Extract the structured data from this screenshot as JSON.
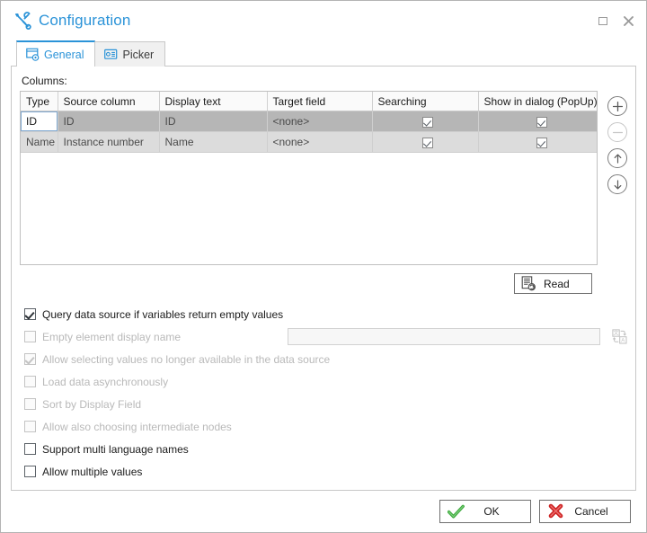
{
  "window": {
    "title": "Configuration",
    "title_icon": "tools-icon",
    "buttons": {
      "maximize": "maximize-icon",
      "close": "close-icon"
    }
  },
  "tabs": [
    {
      "label": "General",
      "icon": "window-gear-icon",
      "active": true
    },
    {
      "label": "Picker",
      "icon": "card-list-icon",
      "active": false
    }
  ],
  "general": {
    "columns_label": "Columns:",
    "grid": {
      "headers": [
        "Type",
        "Source column",
        "Display text",
        "Target field",
        "Searching",
        "Show in dialog (PopUp)"
      ],
      "rows": [
        {
          "type": "ID",
          "source_column": "ID",
          "display_text": "ID",
          "target_field": "<none>",
          "searching": true,
          "show_in_dialog": true,
          "selected": true,
          "editing_cell": "type"
        },
        {
          "type": "Name",
          "source_column": "Instance number",
          "display_text": "Name",
          "target_field": "<none>",
          "searching": true,
          "show_in_dialog": true,
          "selected": false,
          "editing_cell": null
        }
      ]
    },
    "side_tools": [
      {
        "name": "add-row-button",
        "icon": "plus-circle-icon",
        "disabled": false
      },
      {
        "name": "remove-row-button",
        "icon": "minus-circle-icon",
        "disabled": true
      },
      {
        "name": "move-up-button",
        "icon": "arrow-up-circle-icon",
        "disabled": false
      },
      {
        "name": "move-down-button",
        "icon": "arrow-down-circle-icon",
        "disabled": false
      }
    ],
    "read_button": {
      "label": "Read",
      "icon": "read-data-icon"
    },
    "options": [
      {
        "label": "Query data source if variables return empty values",
        "checked": true,
        "disabled": false,
        "has_input": false
      },
      {
        "label": "Empty element display name",
        "checked": false,
        "disabled": true,
        "has_input": true,
        "input_value": "",
        "input_placeholder": ""
      },
      {
        "label": "Allow selecting values no longer available in the data source",
        "checked": true,
        "disabled": true,
        "has_input": false
      },
      {
        "label": "Load data asynchronously",
        "checked": false,
        "disabled": true,
        "has_input": false
      },
      {
        "label": "Sort by Display Field",
        "checked": false,
        "disabled": true,
        "has_input": false
      },
      {
        "label": "Allow also choosing intermediate nodes",
        "checked": false,
        "disabled": true,
        "has_input": false
      },
      {
        "label": "Support multi language names",
        "checked": false,
        "disabled": false,
        "has_input": false
      },
      {
        "label": "Allow multiple values",
        "checked": false,
        "disabled": false,
        "has_input": false
      }
    ]
  },
  "footer": {
    "ok_label": "OK",
    "cancel_label": "Cancel",
    "ok_icon": "green-check-icon",
    "cancel_icon": "red-x-icon"
  },
  "colors": {
    "accent": "#2b93d8",
    "ok_green": "#3faa3f",
    "cancel_red": "#cc2222",
    "row_selected": "#b6b6b6",
    "row_normal": "#dcdcdc"
  }
}
